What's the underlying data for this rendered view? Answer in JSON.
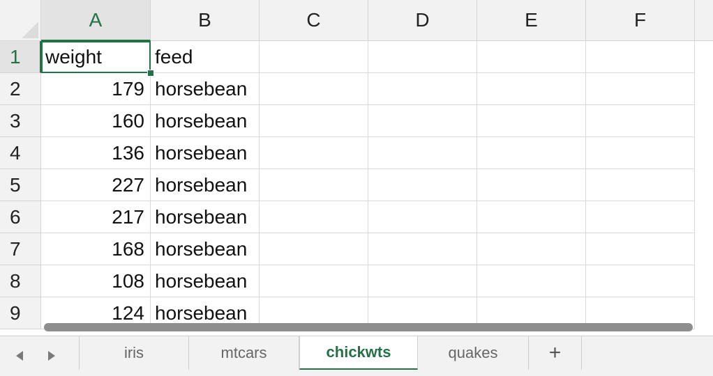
{
  "columns": [
    "A",
    "B",
    "C",
    "D",
    "E",
    "F"
  ],
  "rows": [
    {
      "n": "1",
      "a": "weight",
      "b": "feed"
    },
    {
      "n": "2",
      "a": "179",
      "b": "horsebean"
    },
    {
      "n": "3",
      "a": "160",
      "b": "horsebean"
    },
    {
      "n": "4",
      "a": "136",
      "b": "horsebean"
    },
    {
      "n": "5",
      "a": "227",
      "b": "horsebean"
    },
    {
      "n": "6",
      "a": "217",
      "b": "horsebean"
    },
    {
      "n": "7",
      "a": "168",
      "b": "horsebean"
    },
    {
      "n": "8",
      "a": "108",
      "b": "horsebean"
    },
    {
      "n": "9",
      "a": "124",
      "b": "horsebean"
    }
  ],
  "selected_cell": "A1",
  "sheet_tabs": [
    {
      "label": "iris"
    },
    {
      "label": "mtcars"
    },
    {
      "label": "chickwts",
      "active": true
    },
    {
      "label": "quakes"
    }
  ],
  "add_sheet_label": "+",
  "nav": {
    "prev_icon": "triangle-left-icon",
    "next_icon": "triangle-right-icon"
  },
  "colors": {
    "accent": "#217346"
  }
}
